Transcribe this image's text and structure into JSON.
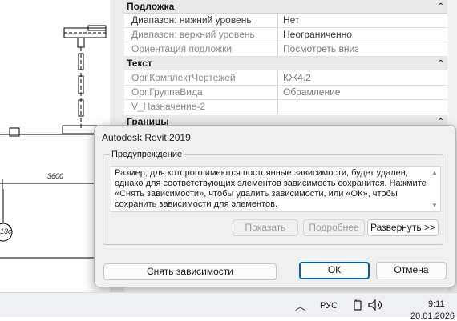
{
  "drawing": {
    "dimension_text": "3600",
    "grid_bubble_text": "13с"
  },
  "properties": {
    "categories": [
      {
        "label": "Подложка",
        "chevron": "⌃"
      },
      {
        "label": "Текст",
        "chevron": "⌃"
      },
      {
        "label": "Границы",
        "chevron": "⌃"
      }
    ],
    "rows": [
      {
        "name": "Диапазон: нижний уровень",
        "value": "Нет"
      },
      {
        "name": "Диапазон: верхний уровень",
        "value": "Неограниченно"
      },
      {
        "name": "Ориентация подложки",
        "value": "Посмотреть вниз"
      },
      {
        "name": "Орг.КомплектЧертежей",
        "value": "КЖ4.2"
      },
      {
        "name": "Орг.ГруппаВида",
        "value": "Обрамление"
      },
      {
        "name": "V_Назначение-2",
        "value": ""
      }
    ]
  },
  "dialog": {
    "title": "Autodesk Revit 2019",
    "group_label": "Предупреждение",
    "message": "Размер, для которого имеются постоянные зависимости, будет удален, однако для соответствующих элементов зависимость сохранится. Нажмите «Снять зависимости», чтобы удалить зависимости, или «ОК», чтобы сохранить зависимости для элементов.",
    "buttons": {
      "show": "Показать",
      "more": "Подробнее",
      "expand": "Развернуть >>",
      "remove_constraints": "Снять зависимости",
      "ok": "ОК",
      "cancel": "Отмена"
    }
  },
  "taskbar": {
    "language": "РУС",
    "time": "9:11",
    "date": "20.01.2026"
  }
}
